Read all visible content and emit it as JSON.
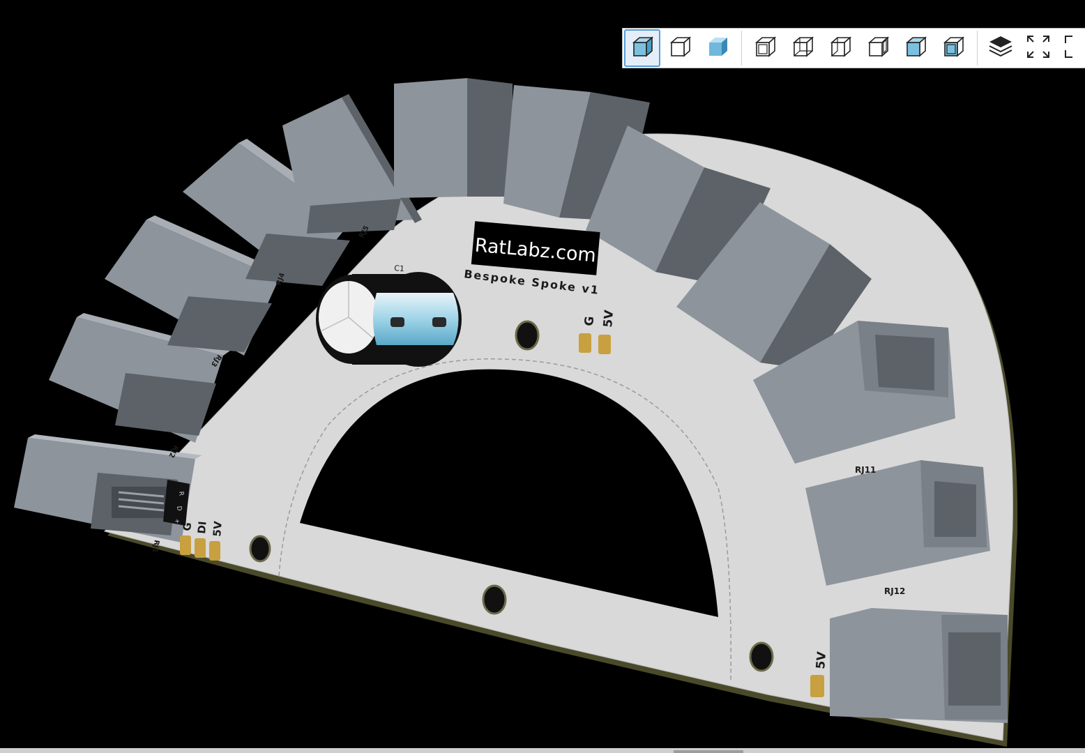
{
  "board": {
    "logo_text": "RatLabz.com",
    "title_text": "Bespoke Spoke v1",
    "capacitor_label": "C1",
    "pads_top": [
      "G",
      "5V"
    ],
    "pads_left": [
      "G",
      "DI",
      "5V"
    ],
    "pads_right": [
      "5V"
    ],
    "header_marks": [
      "R",
      "D",
      "+"
    ],
    "connectors": [
      "RJ1",
      "RJ2",
      "RJ3",
      "RJ4",
      "RJ5",
      "RJ11",
      "RJ12"
    ]
  },
  "colors": {
    "background": "#000000",
    "board": "#d9d9d9",
    "board_edge": "#4a4a2a",
    "rj_body": "#8d949c",
    "rj_dark": "#5d6268",
    "pad_gold": "#c8a040",
    "accent_blue": "#5b9bd5"
  },
  "toolbar": {
    "buttons": [
      {
        "icon": "cube-shaded-icon"
      },
      {
        "icon": "cube-wireframe-icon"
      },
      {
        "icon": "cube-solid-blue-icon"
      },
      {
        "icon": "view-front-icon"
      },
      {
        "icon": "view-back-icon"
      },
      {
        "icon": "view-left-icon"
      },
      {
        "icon": "view-right-icon"
      },
      {
        "icon": "view-top-icon"
      },
      {
        "icon": "view-bottom-icon"
      },
      {
        "icon": "layers-icon"
      },
      {
        "icon": "fit-to-view-icon"
      },
      {
        "icon": "fullscreen-icon"
      }
    ]
  }
}
